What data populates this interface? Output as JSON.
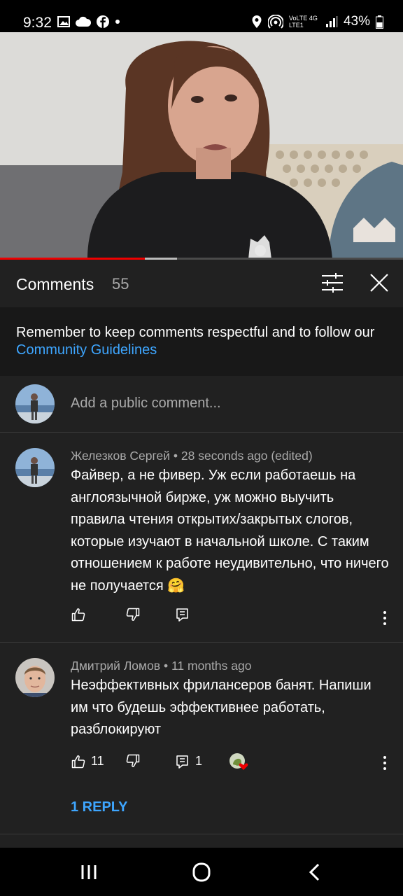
{
  "status_bar": {
    "time": "9:32",
    "network": "VoLTE 4G LTE1",
    "battery": "43%",
    "icons": [
      "image-icon",
      "cloud-icon",
      "facebook-icon",
      "dot-icon",
      "location-icon",
      "hotspot-icon",
      "signal-icon",
      "battery-icon"
    ]
  },
  "video": {
    "progress_played": 0.36,
    "progress_buffered_end": 0.44
  },
  "comments_panel": {
    "title": "Comments",
    "count": "55",
    "notice_prefix": "Remember to keep comments respectful and to follow our",
    "notice_link": "Community Guidelines",
    "add_placeholder": "Add a public comment..."
  },
  "comments": [
    {
      "author": "Железков Сергей",
      "time": "28 seconds ago (edited)",
      "text": "Файвер, а не фивер. Уж если работаешь на англоязычной бирже, уж можно выучить правила чтения открытих/закрытых слогов, которые изучают в начальной школе. С таким отношением к работе неудивительно, что ничего не получается 🤗",
      "likes": "",
      "replies": ""
    },
    {
      "author": "Дмитрий Ломов",
      "time": "11 months ago",
      "text": "Неэффективных фрилансеров банят. Напиши им что будешь эффективнее работать, разблокируют",
      "likes": "11",
      "replies": "1",
      "reply_link": "1 REPLY"
    }
  ],
  "colors": {
    "panel_bg": "#212121",
    "notice_bg": "#181818",
    "link": "#3ea6ff",
    "progress": "#ff0000"
  }
}
